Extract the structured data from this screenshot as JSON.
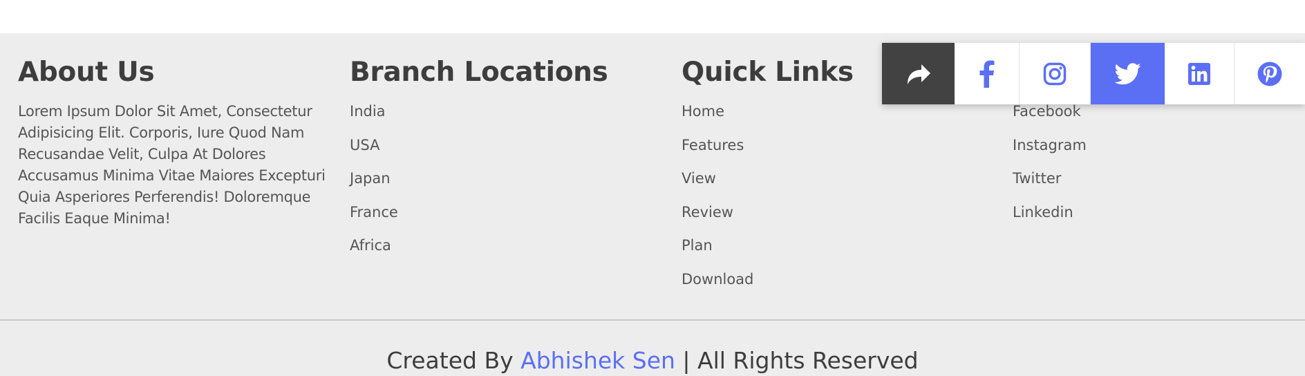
{
  "about": {
    "title": "About Us",
    "text": "Lorem Ipsum Dolor Sit Amet, Consectetur Adipisicing Elit. Corporis, Iure Quod Nam Recusandae Velit, Culpa At Dolores Accusamus Minima Vitae Maiores Excepturi Quia Asperiores Perferendis! Doloremque Facilis Eaque Minima!"
  },
  "branches": {
    "title": "Branch Locations",
    "items": [
      "India",
      "USA",
      "Japan",
      "France",
      "Africa"
    ]
  },
  "quick_links": {
    "title": "Quick Links",
    "items": [
      "Home",
      "Features",
      "View",
      "Review",
      "Plan",
      "Download"
    ]
  },
  "follow": {
    "items": [
      "Facebook",
      "Instagram",
      "Twitter",
      "Linkedin"
    ]
  },
  "credit": {
    "prefix": "Created By",
    "author": "Abhishek Sen",
    "suffix": "| All Rights Reserved"
  },
  "share_bar": {
    "icons": [
      "share-icon",
      "facebook-icon",
      "instagram-icon",
      "twitter-icon",
      "linkedin-icon",
      "pinterest-icon"
    ]
  },
  "colors": {
    "accent": "#5b6ff5",
    "footer_bg": "#ededed",
    "share_dark": "#424242",
    "text": "#555555",
    "heading": "#3d3d3d"
  }
}
